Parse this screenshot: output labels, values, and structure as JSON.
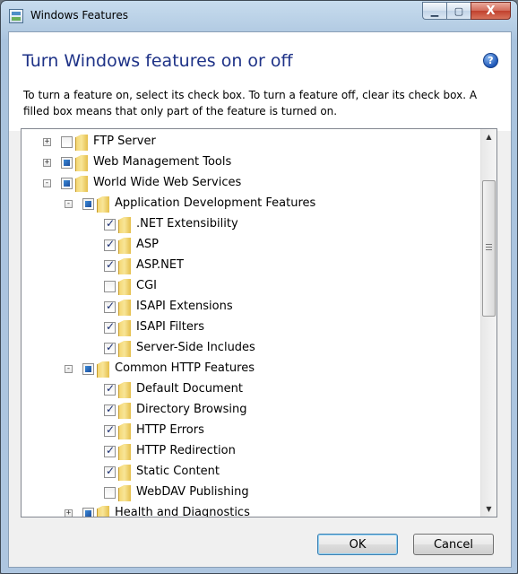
{
  "window": {
    "title": "Windows Features",
    "min_glyph": "▁",
    "max_glyph": "▢",
    "close_glyph": "X"
  },
  "header": {
    "heading": "Turn Windows features on or off",
    "help_glyph": "?",
    "instructions": "To turn a feature on, select its check box. To turn a feature off, clear its check box. A filled box means that only part of the feature is turned on."
  },
  "tree": {
    "items": [
      {
        "label": "FTP Server",
        "level": 0,
        "expander": "+",
        "state": "unchecked"
      },
      {
        "label": "Web Management Tools",
        "level": 0,
        "expander": "+",
        "state": "partial"
      },
      {
        "label": "World Wide Web Services",
        "level": 0,
        "expander": "-",
        "state": "partial"
      },
      {
        "label": "Application Development Features",
        "level": 1,
        "expander": "-",
        "state": "partial"
      },
      {
        "label": ".NET Extensibility",
        "level": 2,
        "expander": "",
        "state": "checked"
      },
      {
        "label": "ASP",
        "level": 2,
        "expander": "",
        "state": "checked"
      },
      {
        "label": "ASP.NET",
        "level": 2,
        "expander": "",
        "state": "checked"
      },
      {
        "label": "CGI",
        "level": 2,
        "expander": "",
        "state": "unchecked"
      },
      {
        "label": "ISAPI Extensions",
        "level": 2,
        "expander": "",
        "state": "checked"
      },
      {
        "label": "ISAPI Filters",
        "level": 2,
        "expander": "",
        "state": "checked"
      },
      {
        "label": "Server-Side Includes",
        "level": 2,
        "expander": "",
        "state": "checked"
      },
      {
        "label": "Common HTTP Features",
        "level": 1,
        "expander": "-",
        "state": "partial"
      },
      {
        "label": "Default Document",
        "level": 2,
        "expander": "",
        "state": "checked"
      },
      {
        "label": "Directory Browsing",
        "level": 2,
        "expander": "",
        "state": "checked"
      },
      {
        "label": "HTTP Errors",
        "level": 2,
        "expander": "",
        "state": "checked"
      },
      {
        "label": "HTTP Redirection",
        "level": 2,
        "expander": "",
        "state": "checked"
      },
      {
        "label": "Static Content",
        "level": 2,
        "expander": "",
        "state": "checked"
      },
      {
        "label": "WebDAV Publishing",
        "level": 2,
        "expander": "",
        "state": "unchecked"
      },
      {
        "label": "Health and Diagnostics",
        "level": 1,
        "expander": "+",
        "state": "partial"
      }
    ],
    "scroll_up_glyph": "▲",
    "scroll_down_glyph": "▼"
  },
  "buttons": {
    "ok_label": "OK",
    "cancel_label": "Cancel"
  }
}
